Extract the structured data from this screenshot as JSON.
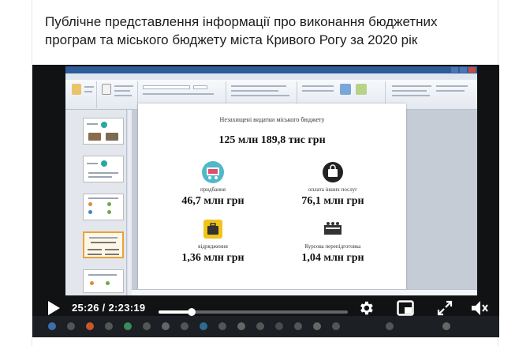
{
  "post": {
    "title": "Публічне представлення інформації про виконання бюджетних програм та міського бюджету міста Кривого Рогу за 2020 рік"
  },
  "player": {
    "current_time": "25:26",
    "separator": " / ",
    "duration": "2:23:19",
    "progress_fraction": 0.177
  },
  "slide": {
    "heading": "Незахищені видатки міського бюджету",
    "total": "125 млн 189,8 тис грн",
    "items": [
      {
        "label": "придбання",
        "value": "46,7 млн грн",
        "icon": "cart-icon"
      },
      {
        "label": "оплата інших послуг",
        "value": "76,1 млн грн",
        "icon": "bag-icon"
      },
      {
        "label": "відрядження",
        "value": "1,36 млн грн",
        "icon": "suitcase-icon"
      },
      {
        "label": "Курсова перепідготовка",
        "value": "1,04 млн грн",
        "icon": "training-icon"
      }
    ]
  },
  "colors": {
    "title_bar": "#2e5c99",
    "file_tab": "#c9562b",
    "selected_thumb": "#e8a23b",
    "background": "#101214"
  }
}
